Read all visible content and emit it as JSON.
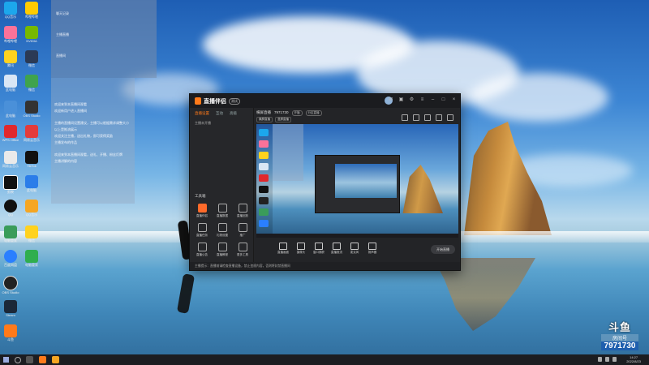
{
  "desktop": {
    "icons": [
      {
        "name": "QQ音乐"
      },
      {
        "name": "哔哩哔哩"
      },
      {
        "name": "NVIDIA"
      },
      {
        "name": "腾讯"
      },
      {
        "name": "微信"
      },
      {
        "name": "此电脑"
      },
      {
        "name": "WPS Office"
      },
      {
        "name": "网易云音乐"
      },
      {
        "name": "TikTok"
      },
      {
        "name": "剪映"
      },
      {
        "name": "QQ"
      },
      {
        "name": "电脑管家"
      },
      {
        "name": "百度网盘"
      },
      {
        "name": "OBS Studio"
      },
      {
        "name": "Steam"
      },
      {
        "name": "斗鱼"
      }
    ]
  },
  "chat": {
    "rows": [
      "聊天记录",
      "主播直播",
      "直播间"
    ],
    "messages": [
      "欢迎来到本直播间观看",
      "欢迎新用户进入直播间",
      "主播的直播间设置建议，主播可以根据需求调整大小",
      "以上是推流展示",
      "欢迎关注主播，送出礼物，即可获得奖励",
      "主播发布的作品",
      "欢迎来到本直播间观看，送礼、开播、粉丝灯牌",
      "主播讲解的内容"
    ]
  },
  "app": {
    "name": "直播伴侣",
    "badge": "测试",
    "left_tabs": [
      "直播设置",
      "互动",
      "高级"
    ],
    "left_rows": [
      "主播未开播",
      "设置"
    ],
    "tools_title": "工具箱",
    "tools": [
      "直播伴侣",
      "直播数据",
      "直播回放",
      "直播任务",
      "礼物设置",
      "推广",
      "直播公告",
      "直播教程",
      "更多工具"
    ],
    "stage_title": "横屏直播",
    "stage_id": "7971730",
    "stage_tag": "开播",
    "stage_tag2": "分区直播",
    "chips": [
      "横屏直播",
      "竖屏直播"
    ],
    "toolbar": [
      "直播画面",
      "摄像头",
      "窗口捕获",
      "直播推流",
      "麦克风",
      "扬声器"
    ],
    "start_label": "开始直播",
    "notice": "主播提示：直播前请检查直播设备，禁止违规内容，否则将封禁直播间"
  },
  "watermark": {
    "brand": "斗鱼",
    "label": "房间号",
    "room": "7971730"
  },
  "taskbar": {
    "time": "14:27",
    "date": "2022/8/23"
  }
}
